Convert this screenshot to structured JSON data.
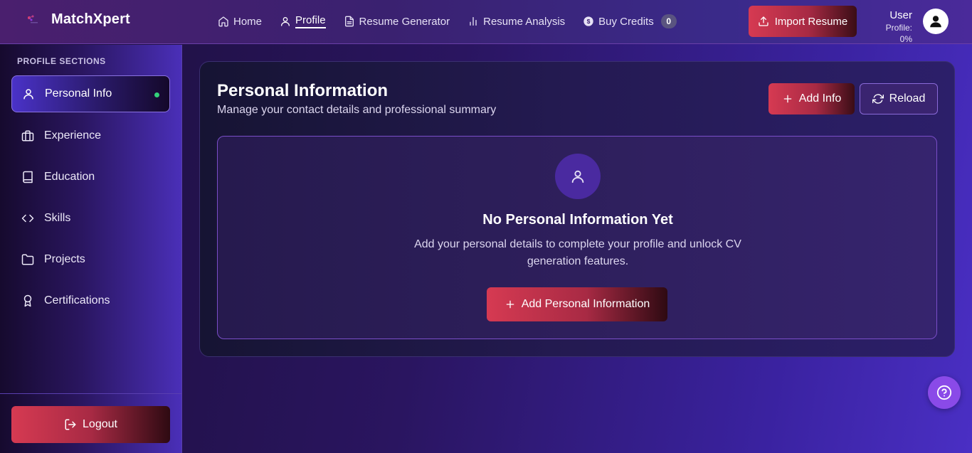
{
  "app": {
    "brand_name": "MatchXpert"
  },
  "nav": {
    "items": [
      {
        "label": "Home",
        "icon": "home-icon"
      },
      {
        "label": "Profile",
        "icon": "user-icon",
        "active": true
      },
      {
        "label": "Resume Generator",
        "icon": "document-icon"
      },
      {
        "label": "Resume Analysis",
        "icon": "bar-chart-icon"
      },
      {
        "label": "Buy Credits",
        "icon": "dollar-icon"
      }
    ],
    "credits": "0"
  },
  "header": {
    "import_label": "Import Resume",
    "user_name": "User",
    "profile_progress": "Profile: 0%"
  },
  "sidebar": {
    "title": "PROFILE SECTIONS",
    "items": [
      {
        "label": "Personal Info",
        "icon": "user-icon",
        "active": true
      },
      {
        "label": "Experience",
        "icon": "briefcase-icon"
      },
      {
        "label": "Education",
        "icon": "book-icon"
      },
      {
        "label": "Skills",
        "icon": "code-icon"
      },
      {
        "label": "Projects",
        "icon": "folder-icon"
      },
      {
        "label": "Certifications",
        "icon": "award-icon"
      }
    ],
    "logout_label": "Logout"
  },
  "main": {
    "title": "Personal Information",
    "subtitle": "Manage your contact details and professional summary",
    "add_info_label": "Add Info",
    "reload_label": "Reload",
    "empty": {
      "title": "No Personal Information Yet",
      "description": "Add your personal details to complete your profile and unlock CV generation features.",
      "button_label": "Add Personal Information"
    }
  },
  "colors": {
    "accent_red": "#d63a52",
    "active_dot": "#34d17a",
    "help_button": "#8a4ae8"
  }
}
